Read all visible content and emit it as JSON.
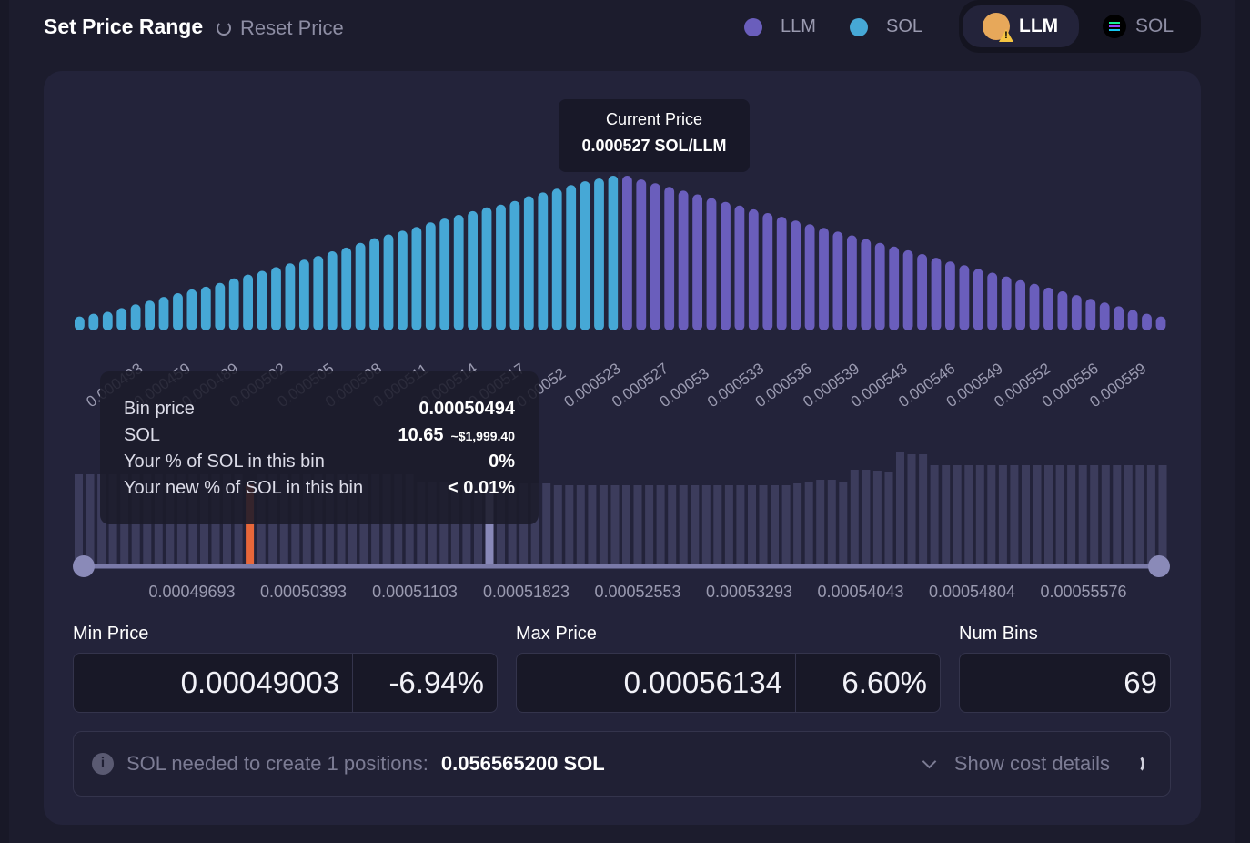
{
  "header": {
    "title": "Set Price Range",
    "reset_label": "Reset Price",
    "legend": [
      {
        "label": "LLM",
        "color": "#6a5ebc"
      },
      {
        "label": "SOL",
        "color": "#46a8d6"
      }
    ],
    "toggle": {
      "active": "LLM",
      "inactive": "SOL"
    }
  },
  "current_price": {
    "label": "Current Price",
    "value": "0.000527 SOL/LLM"
  },
  "bin_tooltip": {
    "rows": [
      {
        "label": "Bin price",
        "value": "0.00050494",
        "extra": ""
      },
      {
        "label": "SOL",
        "value": "10.65",
        "extra": "~$1,999.40"
      },
      {
        "label": "Your % of SOL in this bin",
        "value": "0%",
        "extra": ""
      },
      {
        "label": "Your new % of SOL in this bin",
        "value": "< 0.01%",
        "extra": ""
      }
    ]
  },
  "chart_data": [
    {
      "type": "bar",
      "title": "",
      "colors": {
        "sol": "#46a8d6",
        "llm": "#6a5ebc"
      },
      "categories": [
        "0.000493",
        "0.000459",
        "0.000489",
        "0.000502",
        "0.000505",
        "0.000508",
        "0.000511",
        "0.000514",
        "0.000517",
        "0.00052",
        "0.000523",
        "0.000527",
        "0.00053",
        "0.000533",
        "0.000536",
        "0.000539",
        "0.000543",
        "0.000546",
        "0.000549",
        "0.000552",
        "0.000556",
        "0.000559"
      ],
      "series": [
        {
          "name": "SOL",
          "values": [
            15,
            18,
            20,
            24,
            28,
            32,
            36,
            40,
            44,
            47,
            51,
            56,
            60,
            64,
            68,
            72,
            76,
            80,
            85,
            89,
            94,
            99,
            103,
            107,
            111,
            116,
            120,
            124,
            128,
            132,
            135,
            139,
            144,
            148,
            152,
            156,
            160,
            163,
            166
          ]
        },
        {
          "name": "LLM",
          "values": [
            166,
            162,
            158,
            154,
            150,
            146,
            142,
            138,
            134,
            130,
            126,
            122,
            118,
            114,
            110,
            106,
            102,
            98,
            94,
            90,
            86,
            82,
            78,
            74,
            70,
            66,
            62,
            58,
            54,
            50,
            46,
            42,
            38,
            34,
            30,
            26,
            22,
            18,
            15
          ]
        }
      ]
    },
    {
      "type": "bar",
      "title": "",
      "ticks": [
        "0.00049693",
        "0.00050393",
        "0.00051103",
        "0.00051823",
        "0.00052553",
        "0.00053293",
        "0.00054043",
        "0.00054804",
        "0.00055576"
      ],
      "highlight_bin": 15,
      "current_bin": 36,
      "highlight_color": "#e8673a",
      "values": [
        98,
        98,
        98,
        98,
        98,
        98,
        98,
        98,
        98,
        98,
        98,
        98,
        98,
        98,
        98,
        87,
        98,
        98,
        98,
        98,
        98,
        98,
        98,
        98,
        98,
        98,
        98,
        98,
        98,
        98,
        90,
        90,
        90,
        90,
        90,
        90,
        88,
        88,
        88,
        88,
        88,
        88,
        86,
        86,
        86,
        86,
        86,
        86,
        86,
        86,
        86,
        86,
        86,
        86,
        86,
        86,
        86,
        86,
        86,
        86,
        86,
        86,
        86,
        88,
        90,
        92,
        92,
        90,
        103,
        103,
        102,
        100,
        122,
        120,
        120,
        108,
        108,
        108,
        108,
        108,
        108,
        108,
        108,
        108,
        108,
        108,
        108,
        108,
        108,
        108,
        108,
        108,
        108,
        108,
        108,
        108
      ]
    }
  ],
  "min_price": {
    "label": "Min Price",
    "value": "0.00049003",
    "pct": "-6.94%"
  },
  "max_price": {
    "label": "Max Price",
    "value": "0.00056134",
    "pct": "6.60%"
  },
  "num_bins": {
    "label": "Num Bins",
    "value": "69"
  },
  "info": {
    "text": "SOL needed to create 1 positions:",
    "value": "0.056565200 SOL",
    "cost_toggle": "Show cost details"
  }
}
